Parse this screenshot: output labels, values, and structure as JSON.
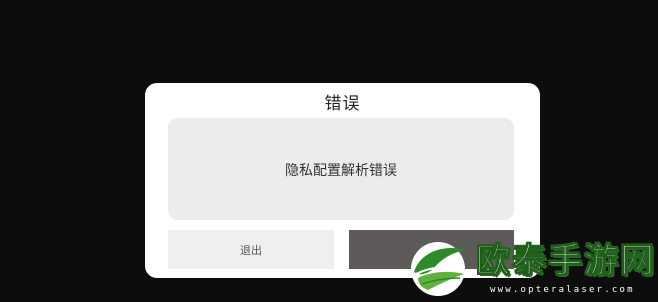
{
  "dialog": {
    "title": "错误",
    "message": "隐私配置解析错误",
    "exit_button_label": "退出",
    "confirm_button_label": ""
  },
  "watermark": {
    "brand_text": "欧泰手游网",
    "url_text": "www.opteralaser.com",
    "logo_icon": "leaf-bird-logo-icon"
  },
  "colors": {
    "background": "#0d0d0d",
    "dialog_bg": "#ffffff",
    "message_box_bg": "#ececec",
    "exit_button_bg": "#efefef",
    "confirm_button_bg": "#5e5a5a",
    "watermark_green": "#2e8b2a"
  }
}
